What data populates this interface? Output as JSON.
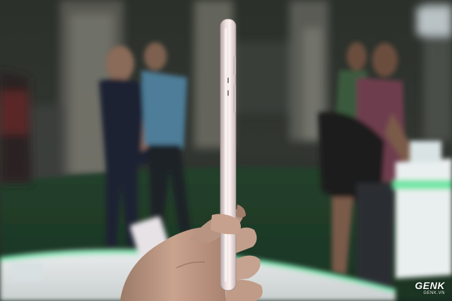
{
  "photo": {
    "subject": "phone-side-profile",
    "watermark": {
      "brand": "GENK",
      "site": "GENK.VN"
    }
  }
}
